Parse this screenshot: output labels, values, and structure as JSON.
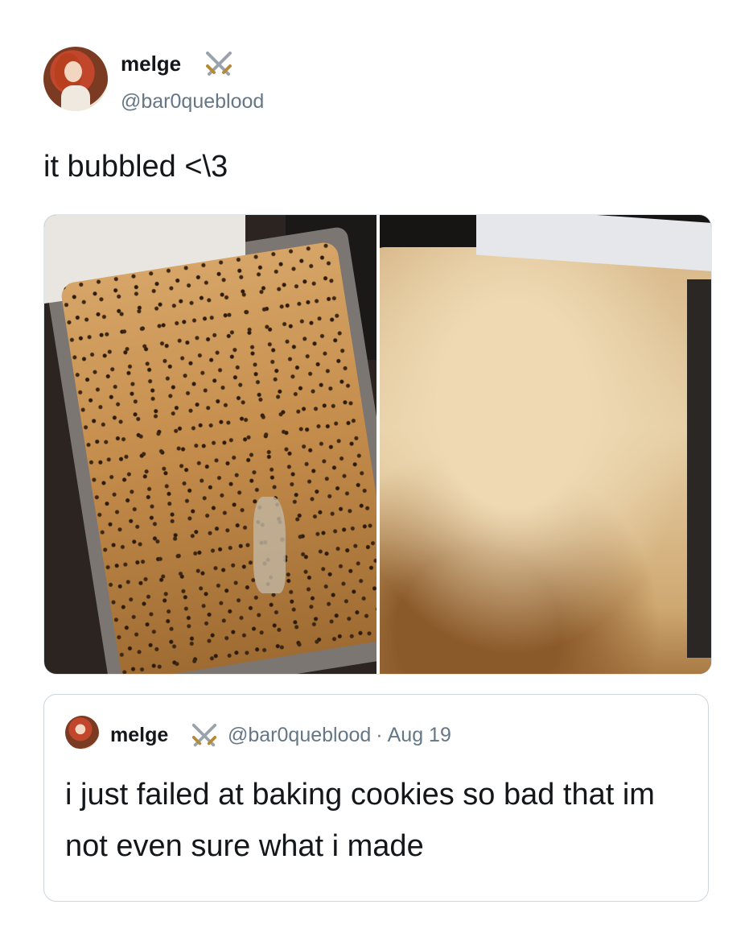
{
  "tweet": {
    "author": {
      "name": "melge",
      "handle": "@bar0queblood",
      "badge_icon": "crossed-swords-icon"
    },
    "text": "it bubbled <\\3",
    "media": [
      {
        "icon": "photo-cookie-tray-1"
      },
      {
        "icon": "photo-cookie-tray-2"
      }
    ]
  },
  "quoted_tweet": {
    "author": {
      "name": "melge",
      "handle": "@bar0queblood",
      "badge_icon": "crossed-swords-icon"
    },
    "separator": "·",
    "date": "Aug 19",
    "text": "i just failed at baking cookies so bad that im not even sure what i made"
  },
  "colors": {
    "text_primary": "#14171a",
    "text_secondary": "#657786",
    "border": "#ccd6dd"
  }
}
